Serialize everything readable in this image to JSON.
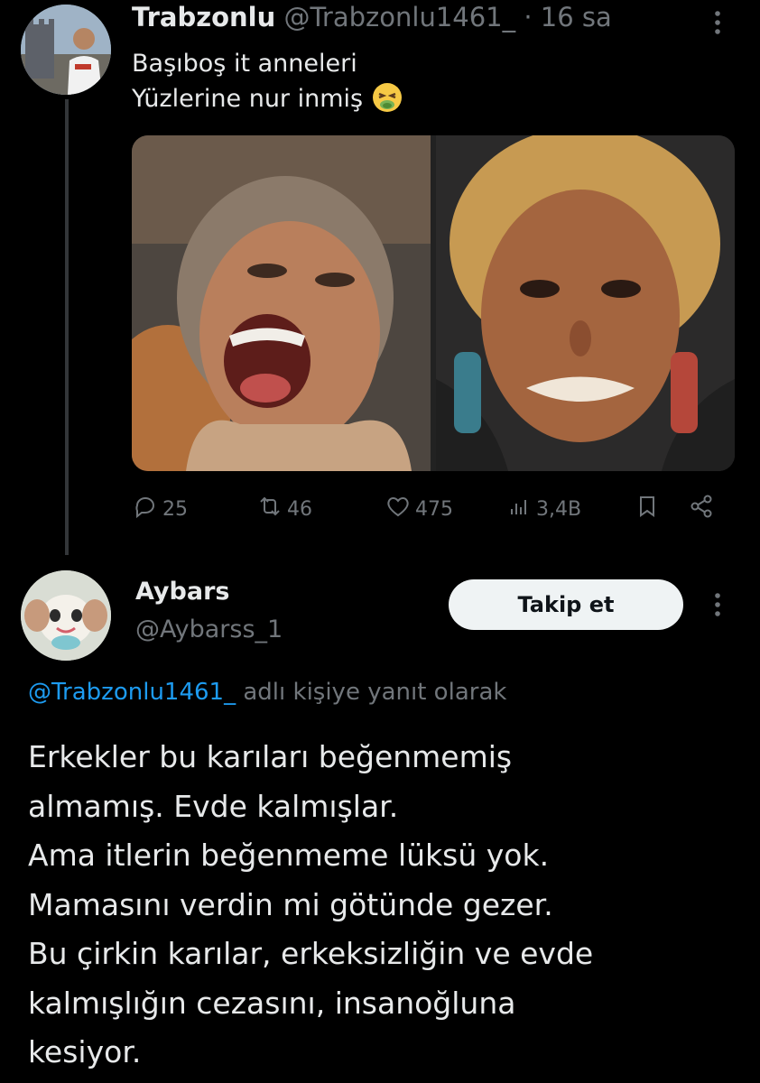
{
  "parent_tweet": {
    "display_name": "Trabzonlu",
    "handle": "@Trabzonlu1461_",
    "time": "· 16 sa",
    "text_lines": [
      "Başıboş it anneleri",
      "Yüzlerine nur inmiş"
    ],
    "emoji": "nauseated-face",
    "stats": {
      "replies": "25",
      "reposts": "46",
      "likes": "475",
      "views": "3,4B"
    }
  },
  "reply_tweet": {
    "display_name": "Aybars",
    "handle": "@Aybarss_1",
    "follow_label": "Takip et",
    "replying_to_mention": "@Trabzonlu1461_",
    "replying_to_suffix": "adlı kişiye yanıt olarak",
    "text": "Erkekler bu karıları beğenmemiş\nalmamış. Evde kalmışlar.\nAma itlerin beğenmeme lüksü yok.\nMamasını verdin mi götünde gezer.\nBu çirkin karılar, erkeksizliğin ve evde\nkalmışlığın cezasını, insanoğluna\nkesiyor."
  },
  "colors": {
    "background": "#000000",
    "text": "#e7e9ea",
    "muted": "#71767b",
    "link": "#1d9bf0",
    "button_bg": "#eff3f4"
  }
}
